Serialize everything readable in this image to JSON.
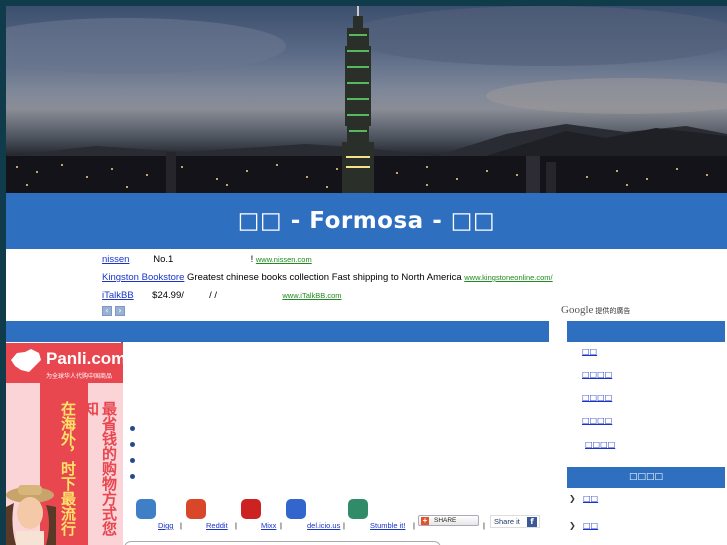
{
  "site": {
    "title": "□□ - Formosa - □□"
  },
  "ads": {
    "items": [
      {
        "link": "nissen",
        "text": "No.1",
        "bang": "!",
        "url": "www.nissen.com"
      },
      {
        "link": "Kingston Bookstore",
        "text": "Greatest chinese books collection Fast shipping to North America",
        "url": "www.kingstoneonline.com/"
      },
      {
        "link": "iTalkBB",
        "text": "$24.99/",
        "slashes": "/ /",
        "url": "www.iTalkBB.com"
      }
    ],
    "nav_prev": "‹",
    "nav_next": "›",
    "google_brand": "Google",
    "google_label": "提供的廣告"
  },
  "side_ad": {
    "logo": "Panli.com",
    "tagline": "为全球华人代购中国商品",
    "text_left": "在海外，时下最流行",
    "text_right": "最省钱的购物方式您知"
  },
  "social": [
    {
      "label": "Digg",
      "color": "#3f7fc6"
    },
    {
      "label": "Reddit",
      "color": "#d9472b"
    },
    {
      "label": "Mixx",
      "color": "#cc2222"
    },
    {
      "label": "del.icio.us",
      "color": "#3366cc"
    },
    {
      "label": "Stumble it!",
      "color": "#2f8b68"
    }
  ],
  "share": {
    "label": "SHARE",
    "plus": "+",
    "fb_label": "Share it",
    "fb_icon": "f"
  },
  "separator": "|",
  "sidebar": {
    "links": [
      "□□",
      "□□□□",
      "□□□□",
      "□□□□",
      "□□□□"
    ],
    "section_title": "□□□□",
    "section_links": [
      "□□",
      "□□"
    ]
  }
}
